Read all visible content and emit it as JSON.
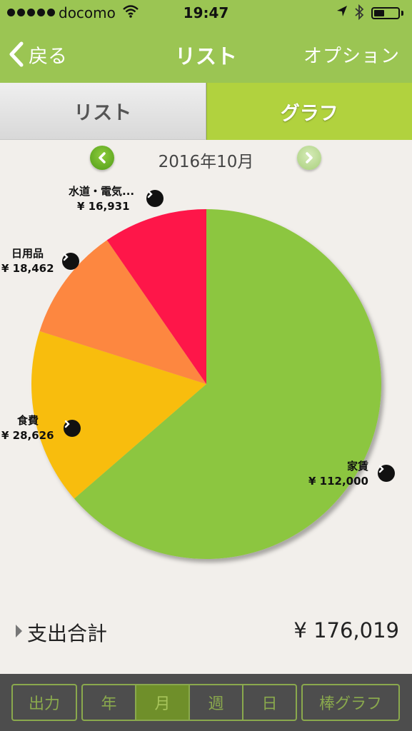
{
  "status": {
    "carrier": "docomo",
    "time": "19:47"
  },
  "nav": {
    "back_label": "戻る",
    "title": "リスト",
    "option_label": "オプション"
  },
  "tabs": {
    "list": "リスト",
    "graph": "グラフ"
  },
  "month": {
    "label": "2016年10月"
  },
  "chart_data": {
    "type": "pie",
    "slices": [
      {
        "name": "家賃",
        "value": 112000,
        "value_label": "¥ 112,000",
        "color": "#8cc63f"
      },
      {
        "name": "食費",
        "value": 28626,
        "value_label": "¥ 28,626",
        "color": "#f8bd0d"
      },
      {
        "name": "日用品",
        "value": 18462,
        "value_label": "¥ 18,462",
        "color": "#fd8741"
      },
      {
        "name": "水道・電気...",
        "value": 16931,
        "value_label": "¥ 16,931",
        "color": "#fe1648"
      }
    ]
  },
  "total": {
    "label": "支出合計",
    "value": "¥ 176,019"
  },
  "toolbar": {
    "output": "出力",
    "year": "年",
    "month": "月",
    "week": "週",
    "day": "日",
    "bar_graph": "棒グラフ"
  }
}
